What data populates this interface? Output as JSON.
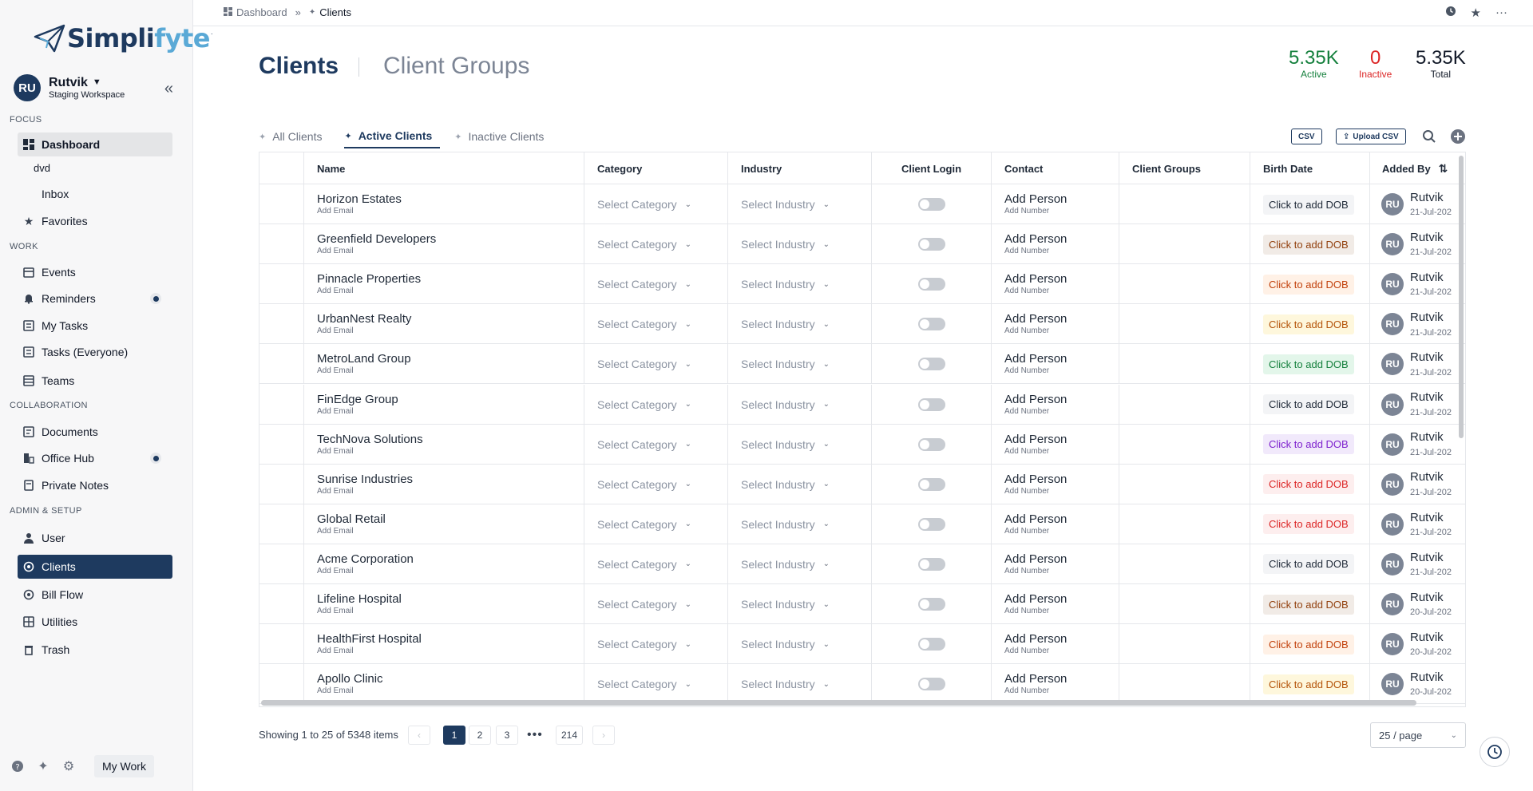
{
  "brand": {
    "name_dark": "Simpli",
    "name_light": "fyte",
    "tm": "."
  },
  "workspace": {
    "initials": "RU",
    "name": "Rutvik",
    "subtitle": "Staging Workspace"
  },
  "sidebar": {
    "sections": [
      {
        "label": "FOCUS"
      },
      {
        "label": "WORK"
      },
      {
        "label": "COLLABORATION"
      },
      {
        "label": "ADMIN & SETUP"
      }
    ],
    "items": [
      {
        "label": "Dashboard",
        "icon": "dashboard-icon"
      },
      {
        "label": "dvd"
      },
      {
        "label": "Inbox",
        "icon": "inbox-icon"
      },
      {
        "label": "Favorites",
        "icon": "star-icon"
      },
      {
        "label": "Events",
        "icon": "calendar-icon"
      },
      {
        "label": "Reminders",
        "icon": "bell-icon"
      },
      {
        "label": "My Tasks",
        "icon": "tasks-icon"
      },
      {
        "label": "Tasks (Everyone)",
        "icon": "tasks-icon"
      },
      {
        "label": "Teams",
        "icon": "teams-icon"
      },
      {
        "label": "Documents",
        "icon": "documents-icon"
      },
      {
        "label": "Office Hub",
        "icon": "office-hub-icon"
      },
      {
        "label": "Private Notes",
        "icon": "notes-icon"
      },
      {
        "label": "User",
        "icon": "user-icon"
      },
      {
        "label": "Clients",
        "icon": "clients-icon"
      },
      {
        "label": "Bill Flow",
        "icon": "bill-icon"
      },
      {
        "label": "Utilities",
        "icon": "utilities-icon"
      },
      {
        "label": "Trash",
        "icon": "trash-icon"
      }
    ],
    "my_work_label": "My Work"
  },
  "breadcrumb": {
    "root": "Dashboard",
    "current": "Clients"
  },
  "header": {
    "title": "Clients",
    "title_secondary": "Client Groups",
    "stats": [
      {
        "value": "5.35K",
        "label": "Active",
        "color": "#15803d"
      },
      {
        "value": "0",
        "label": "Inactive",
        "color": "#dc2626"
      },
      {
        "value": "5.35K",
        "label": "Total",
        "color": "#111827"
      }
    ]
  },
  "tabs": [
    {
      "label": "All Clients"
    },
    {
      "label": "Active Clients"
    },
    {
      "label": "Inactive Clients"
    }
  ],
  "toolbar": {
    "csv_label": "CSV",
    "upload_label": "Upload CSV"
  },
  "table": {
    "columns": [
      "Name",
      "Category",
      "Industry",
      "Client Login",
      "Contact",
      "Client Groups",
      "Birth Date",
      "Added By"
    ],
    "category_placeholder": "Select Category",
    "industry_placeholder": "Select Industry",
    "email_placeholder": "Add Email",
    "contact_label": "Add Person",
    "number_label": "Add Number",
    "dob_label": "Click to add DOB",
    "added_by_initials": "RU",
    "rows": [
      {
        "name": "Horizon Estates",
        "dob_style": "gray",
        "added_by": "Rutvik",
        "date": "21-Jul-202"
      },
      {
        "name": "Greenfield Developers",
        "dob_style": "brown",
        "added_by": "Rutvik",
        "date": "21-Jul-202"
      },
      {
        "name": "Pinnacle Properties",
        "dob_style": "orange",
        "added_by": "Rutvik",
        "date": "21-Jul-202"
      },
      {
        "name": "UrbanNest Realty",
        "dob_style": "yellow",
        "added_by": "Rutvik",
        "date": "21-Jul-202"
      },
      {
        "name": "MetroLand Group",
        "dob_style": "green",
        "added_by": "Rutvik",
        "date": "21-Jul-202"
      },
      {
        "name": "FinEdge Group",
        "dob_style": "gray",
        "added_by": "Rutvik",
        "date": "21-Jul-202"
      },
      {
        "name": "TechNova Solutions",
        "dob_style": "purple",
        "added_by": "Rutvik",
        "date": "21-Jul-202"
      },
      {
        "name": "Sunrise Industries",
        "dob_style": "pink",
        "added_by": "Rutvik",
        "date": "21-Jul-202"
      },
      {
        "name": "Global Retail",
        "dob_style": "pink",
        "added_by": "Rutvik",
        "date": "21-Jul-202"
      },
      {
        "name": "Acme Corporation",
        "dob_style": "gray",
        "added_by": "Rutvik",
        "date": "21-Jul-202"
      },
      {
        "name": "Lifeline Hospital",
        "dob_style": "brown",
        "added_by": "Rutvik",
        "date": "20-Jul-202"
      },
      {
        "name": "HealthFirst Hospital",
        "dob_style": "orange",
        "added_by": "Rutvik",
        "date": "20-Jul-202"
      },
      {
        "name": "Apollo Clinic",
        "dob_style": "yellow",
        "added_by": "Rutvik",
        "date": "20-Jul-202"
      }
    ]
  },
  "pagination": {
    "info": "Showing 1 to 25 of 5348 items",
    "pages": [
      "1",
      "2",
      "3"
    ],
    "last_page": "214",
    "page_size": "25 / page"
  },
  "colors": {
    "primary": "#1e3a5f",
    "dob_gray": [
      "#f3f4f6",
      "#1f2937"
    ],
    "dob_brown": [
      "#f1ebe6",
      "#92400e"
    ],
    "dob_orange": [
      "#fff1e6",
      "#c2410c"
    ],
    "dob_yellow": [
      "#fef7dc",
      "#b45309"
    ],
    "dob_green": [
      "#e3f6ea",
      "#15803d"
    ],
    "dob_purple": [
      "#f1e9fb",
      "#7e22ce"
    ],
    "dob_pink": [
      "#fdeeee",
      "#dc2626"
    ]
  }
}
